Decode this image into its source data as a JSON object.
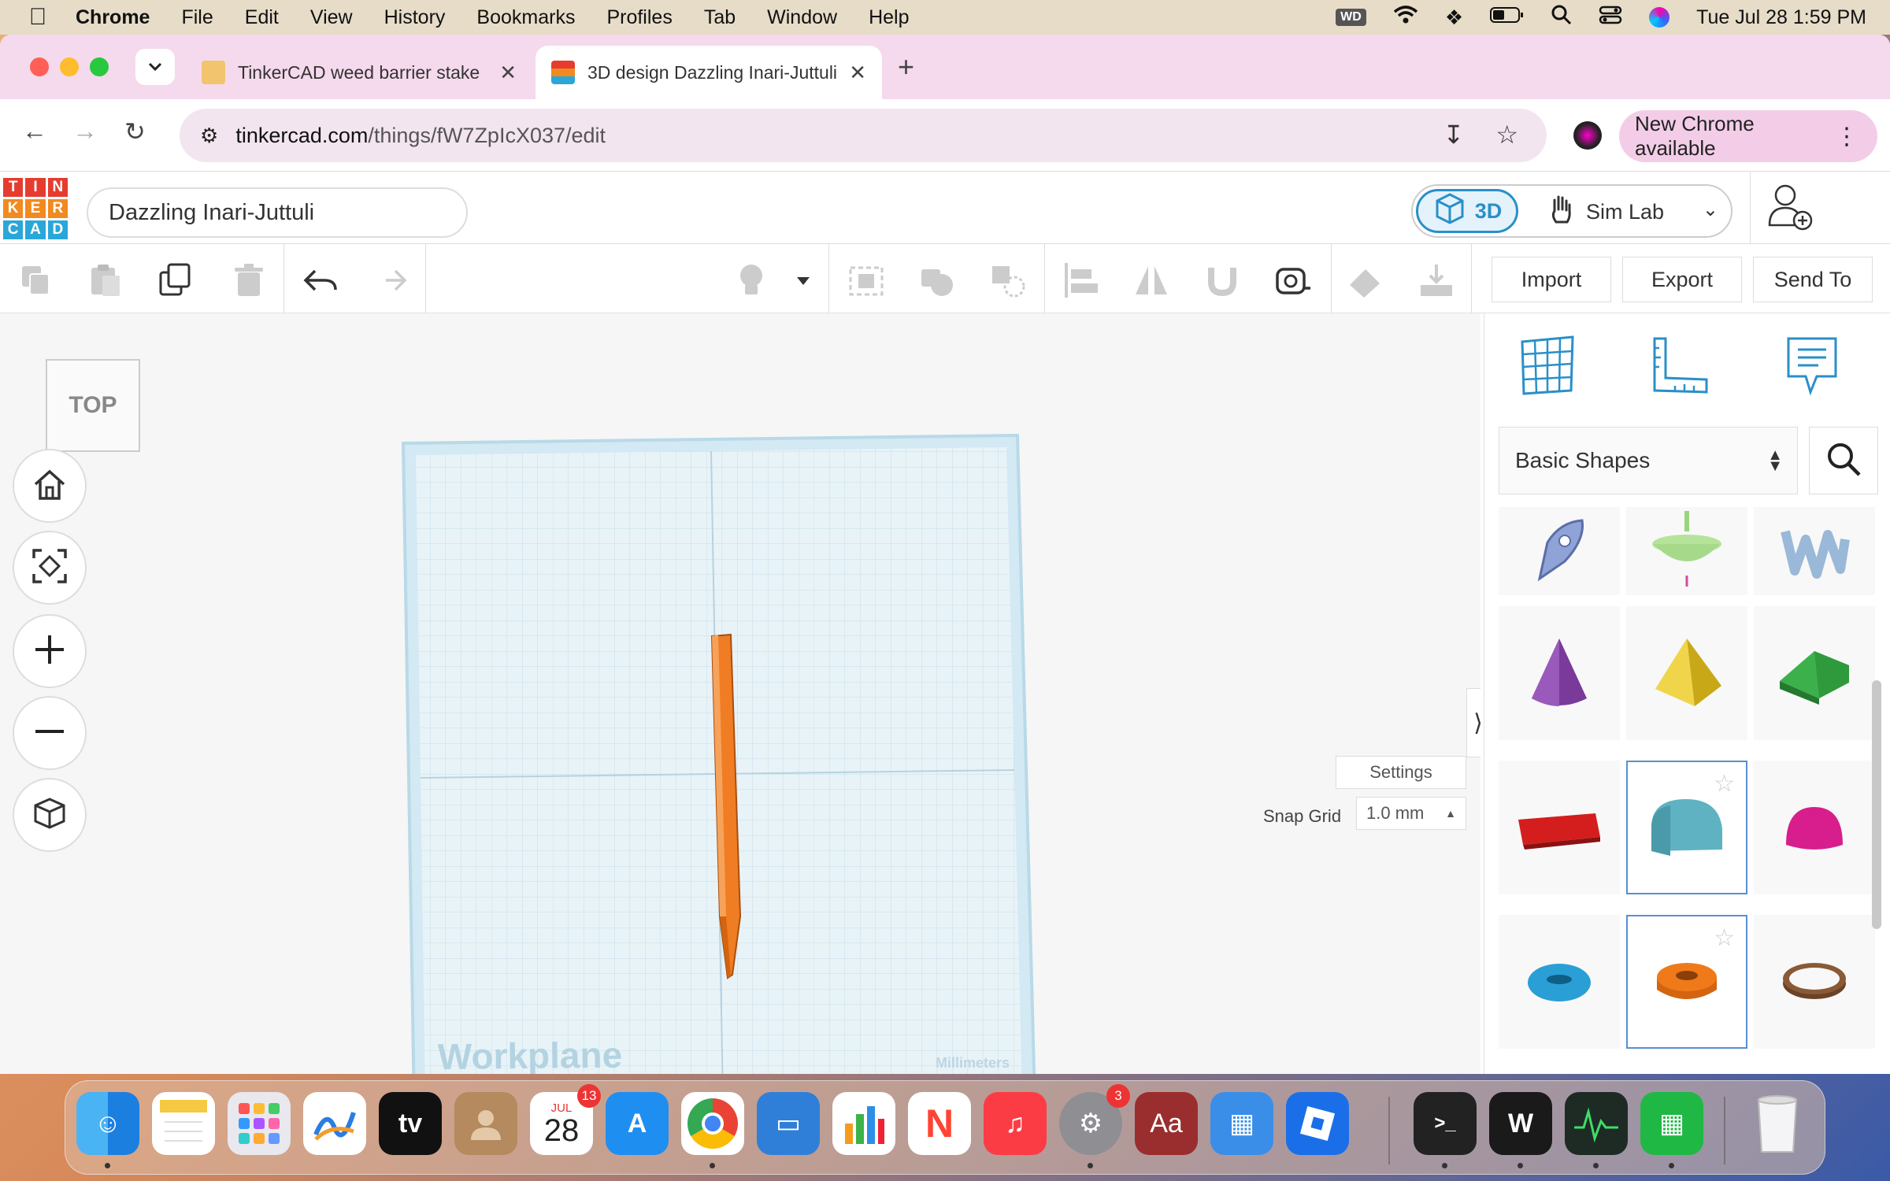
{
  "menubar": {
    "app": "Chrome",
    "items": [
      "File",
      "Edit",
      "View",
      "History",
      "Bookmarks",
      "Profiles",
      "Tab",
      "Window",
      "Help"
    ],
    "wd_badge": "WD",
    "datetime": "Tue Jul 28  1:59 PM"
  },
  "browser": {
    "tabs": [
      {
        "title": "TinkerCAD weed barrier stake"
      },
      {
        "title": "3D design Dazzling Inari-Juttuli"
      }
    ],
    "url_host": "tinkercad.com",
    "url_path": "/things/fW7ZpIcX037/edit",
    "new_chrome_label": "New Chrome available"
  },
  "tinkercad": {
    "logo_letters": [
      "T",
      "I",
      "N",
      "K",
      "E",
      "R",
      "C",
      "A",
      "D"
    ],
    "logo_colors": [
      "#e63c2f",
      "#e63c2f",
      "#e63c2f",
      "#f18a1f",
      "#f18a1f",
      "#f18a1f",
      "#2aa7d9",
      "#2aa7d9",
      "#2aa7d9"
    ],
    "design_name": "Dazzling Inari-Juttuli",
    "mode_3d_label": "3D",
    "mode_sim_label": "Sim Lab",
    "toolbar": {
      "import_label": "Import",
      "export_label": "Export",
      "send_to_label": "Send To"
    },
    "viewcube_label": "TOP",
    "workplane_label": "Workplane",
    "units_label": "Millimeters",
    "settings_label": "Settings",
    "snap_grid_label": "Snap Grid",
    "snap_grid_value": "1.0 mm",
    "shape_category": "Basic Shapes",
    "shapes": [
      {
        "name": "scribble",
        "color": "#8fa3d6"
      },
      {
        "name": "spinning-top",
        "color": "#b6e39a"
      },
      {
        "name": "wave-text",
        "color": "#9ab8d8"
      },
      {
        "name": "cone",
        "color": "#7a3a9a"
      },
      {
        "name": "pyramid",
        "color": "#e8c521"
      },
      {
        "name": "roof",
        "color": "#2f9a3c"
      },
      {
        "name": "text",
        "color": "#d41e1e"
      },
      {
        "name": "half-cylinder",
        "color": "#5fb2c2"
      },
      {
        "name": "hemisphere",
        "color": "#d81e8c"
      },
      {
        "name": "torus",
        "color": "#2a9fd6"
      },
      {
        "name": "tube",
        "color": "#f07a1a"
      },
      {
        "name": "ring",
        "color": "#8a5a36"
      }
    ],
    "accent": "#2a8fc9",
    "stake_color": "#f07d23"
  },
  "dock": {
    "calendar_month": "JUL",
    "calendar_day": "28",
    "calendar_badge": "13",
    "settings_badge": "3",
    "textedit_label": "Aa"
  }
}
